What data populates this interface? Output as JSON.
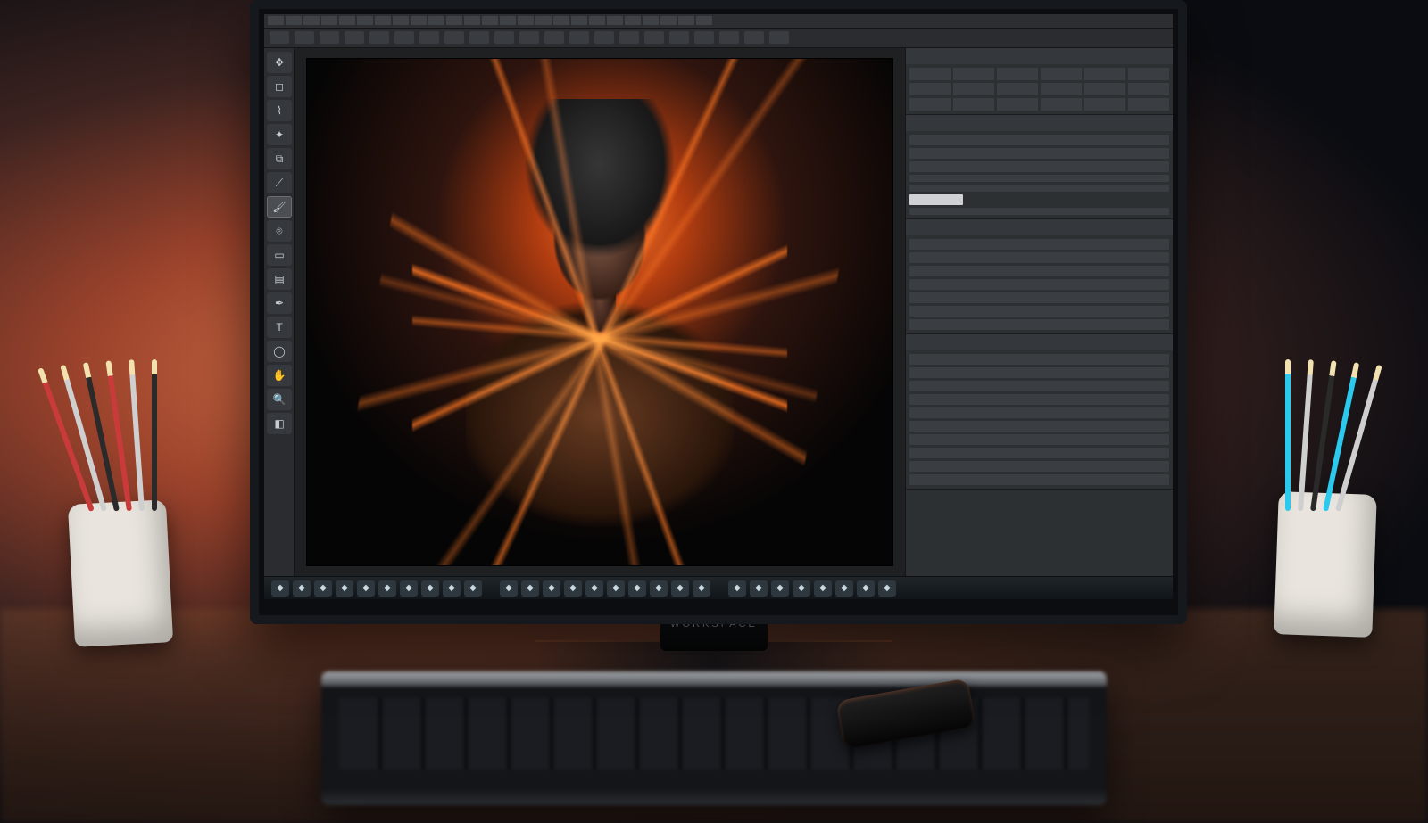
{
  "monitor_brand": "WORKSPACE",
  "app": {
    "menubar_items": [
      "",
      "",
      "",
      "",
      "",
      "",
      "",
      "",
      "",
      "",
      "",
      "",
      "",
      "",
      "",
      "",
      "",
      "",
      "",
      "",
      "",
      "",
      "",
      "",
      ""
    ],
    "optionsbar_items": [
      "",
      "",
      "",
      "",
      "",
      "",
      "",
      "",
      "",
      "",
      "",
      "",
      "",
      "",
      "",
      "",
      "",
      "",
      "",
      "",
      ""
    ]
  },
  "toolbar": {
    "tools": [
      {
        "name": "move-tool",
        "glyph": "✥",
        "active": false
      },
      {
        "name": "marquee-tool",
        "glyph": "◻",
        "active": false
      },
      {
        "name": "lasso-tool",
        "glyph": "⌇",
        "active": false
      },
      {
        "name": "wand-tool",
        "glyph": "✦",
        "active": false
      },
      {
        "name": "crop-tool",
        "glyph": "⧉",
        "active": false
      },
      {
        "name": "eyedropper-tool",
        "glyph": "⟋",
        "active": false
      },
      {
        "name": "brush-tool",
        "glyph": "🖌",
        "active": true
      },
      {
        "name": "stamp-tool",
        "glyph": "⌾",
        "active": false
      },
      {
        "name": "eraser-tool",
        "glyph": "▭",
        "active": false
      },
      {
        "name": "gradient-tool",
        "glyph": "▤",
        "active": false
      },
      {
        "name": "pen-tool",
        "glyph": "✒",
        "active": false
      },
      {
        "name": "text-tool",
        "glyph": "T",
        "active": false
      },
      {
        "name": "shape-tool",
        "glyph": "◯",
        "active": false
      },
      {
        "name": "hand-tool",
        "glyph": "✋",
        "active": false
      },
      {
        "name": "zoom-tool",
        "glyph": "🔍",
        "active": false
      },
      {
        "name": "fg-bg-swatch",
        "glyph": "◧",
        "active": false
      }
    ]
  },
  "panels": [
    {
      "name": "color-swatches",
      "title": "",
      "rows": [
        "grid"
      ]
    },
    {
      "name": "properties",
      "title": "",
      "rows": [
        "row",
        "row",
        "row",
        "thin",
        "thin",
        "highlight",
        "thin"
      ]
    },
    {
      "name": "adjustments",
      "title": "",
      "rows": [
        "row",
        "row",
        "row",
        "row",
        "row",
        "row",
        "row"
      ]
    },
    {
      "name": "layers",
      "title": "",
      "rows": [
        "row",
        "row",
        "row",
        "row",
        "row",
        "row",
        "row",
        "row",
        "row",
        "row"
      ]
    }
  ],
  "bottombar_icons": [
    "app-icon",
    "app-icon",
    "app-icon",
    "app-icon",
    "app-icon",
    "app-icon",
    "app-icon",
    "app-icon",
    "app-icon",
    "app-icon",
    "sep",
    "app-icon",
    "app-icon",
    "app-icon",
    "app-icon",
    "app-icon",
    "app-icon",
    "app-icon",
    "app-icon",
    "app-icon",
    "app-icon",
    "sep",
    "app-icon",
    "app-icon",
    "app-icon",
    "app-icon",
    "app-icon",
    "app-icon",
    "app-icon",
    "app-icon"
  ],
  "desk": {
    "left_pencils": [
      "#c93a3a",
      "#cfcfcf",
      "#2a2a2a",
      "#c93a3a",
      "#cfcfcf",
      "#2a2a2a"
    ],
    "right_pencils": [
      "#2cc9ef",
      "#cfcfcf",
      "#2a2a2a",
      "#2cc9ef",
      "#cfcfcf"
    ]
  }
}
